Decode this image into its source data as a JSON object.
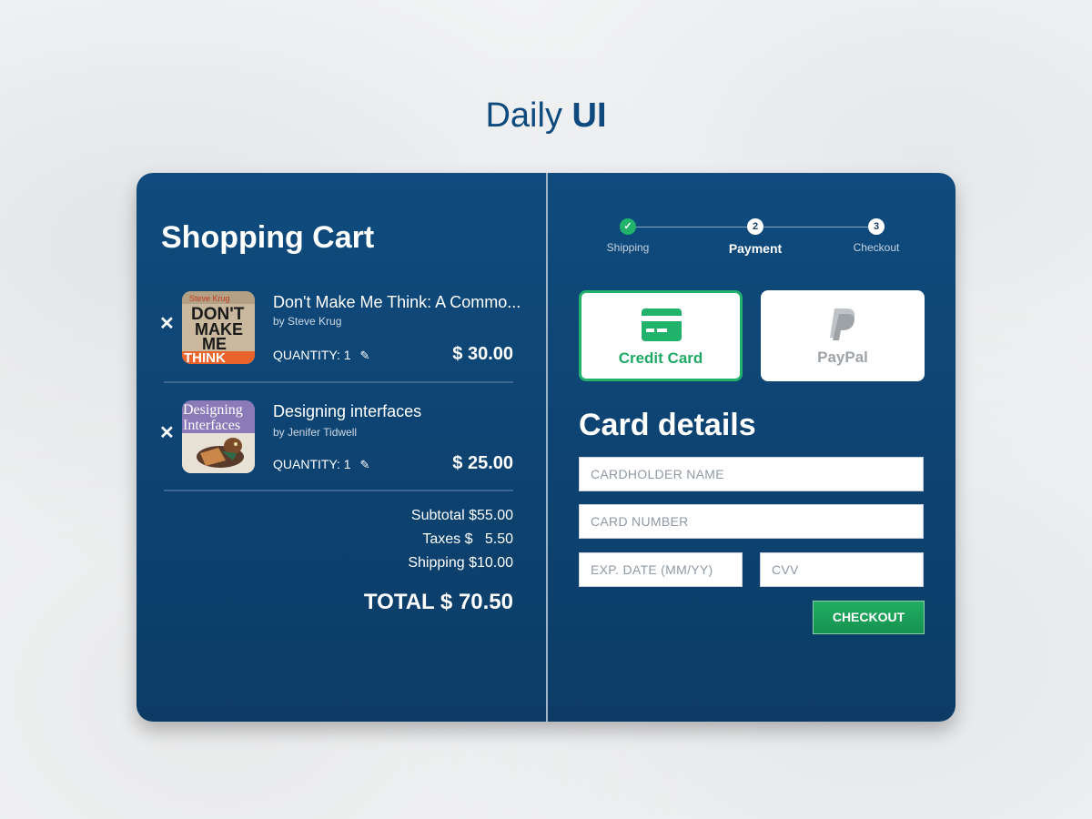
{
  "page": {
    "title_regular": "Daily",
    "title_bold": "UI"
  },
  "cart": {
    "title": "Shopping Cart",
    "items": [
      {
        "name": "Don't Make Me Think: A Commo...",
        "author": "by Steve Krug",
        "quantity_label": "QUANTITY: 1",
        "price": "$ 30.00",
        "cover_lines": [
          "Steve Krug",
          "DON'T",
          "MAKE",
          "ME",
          "THINK"
        ]
      },
      {
        "name": "Designing interfaces",
        "author": "by Jenifer Tidwell",
        "quantity_label": "QUANTITY: 1",
        "price": "$ 25.00",
        "cover_lines": [
          "Designing",
          "Interfaces"
        ]
      }
    ],
    "remove_glyph": "✕",
    "edit_glyph": "✎",
    "subtotal": "Subtotal $55.00",
    "taxes": "Taxes $   5.50",
    "shipping": "Shipping $10.00",
    "total": "TOTAL $ 70.50"
  },
  "steps": [
    {
      "number": "✓",
      "label": "Shipping",
      "state": "done"
    },
    {
      "number": "2",
      "label": "Payment",
      "state": "active"
    },
    {
      "number": "3",
      "label": "Checkout",
      "state": "pending"
    }
  ],
  "payment": {
    "options": [
      {
        "label": "Credit Card",
        "icon": "credit-card-icon",
        "selected": true
      },
      {
        "label": "PayPal",
        "icon": "paypal-icon",
        "selected": false
      }
    ],
    "details_title": "Card details",
    "fields": {
      "cardholder_placeholder": "CARDHOLDER NAME",
      "card_number_placeholder": "CARD NUMBER",
      "exp_placeholder": "EXP. DATE (MM/YY)",
      "cvv_placeholder": "CVV"
    },
    "checkout_label": "CHECKOUT"
  },
  "colors": {
    "accent_green": "#21b36b",
    "panel_blue": "#0f4b7e",
    "title_blue": "#0f4a7f"
  }
}
